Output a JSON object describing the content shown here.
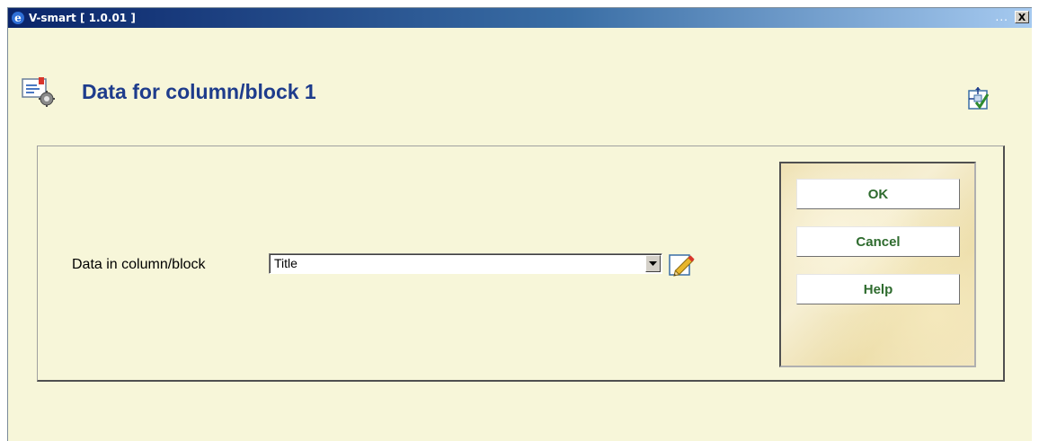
{
  "window": {
    "title": "V-smart [ 1.0.01 ]",
    "dots": "...",
    "close": "X"
  },
  "page": {
    "title": "Data for column/block 1"
  },
  "form": {
    "label": "Data in column/block",
    "select_value": "Title"
  },
  "buttons": {
    "ok": "OK",
    "cancel": "Cancel",
    "help": "Help"
  },
  "icons": {
    "app": "ie-e-icon",
    "header": "document-settings-icon",
    "corner": "layout-check-icon",
    "edit": "pencil-icon",
    "dropdown": "dropdown-arrow-icon"
  },
  "colors": {
    "title_text": "#1e3c8c",
    "button_text": "#2e6b2e",
    "background": "#f7f6d9"
  }
}
